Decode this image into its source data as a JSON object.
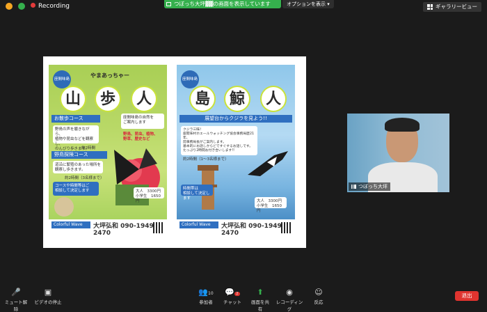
{
  "topbar": {
    "recording": "Recording",
    "share_banner": "つぼっち大坪▓▓の画面を表示しています",
    "options_button": "オプションを表示",
    "gallery_button": "ギャラリービュー"
  },
  "poster1": {
    "tag": "座間味島",
    "subtitle": "やまあっちゃー",
    "title_chars": [
      "山",
      "歩",
      "人"
    ],
    "course1_title": "お散歩コース",
    "course1_text": "座間味島の自然を\nご案内します",
    "course1_items": "野鳥、昆虫、植物、\n野草、歴史など",
    "course1_desc": "野鳥の声を聴きながら、\n植物や昆虫などを観察し、\nのんびり歩きます。",
    "course1_time": "約2時間",
    "course2_title": "野鳥探険コース",
    "course2_desc": "道沿に繁殖のあった場所を\n観察し歩きます。",
    "course2_time": "約2時間（3名様まで）",
    "note": "コースや時間等はご\n相談して決定します",
    "price": "大人　3300円\n小学生　1650円",
    "footer_logo": "Colorful Wave",
    "footer_name": "大坪弘和",
    "footer_phone": "090-1949-2470"
  },
  "poster2": {
    "tag": "座間味島",
    "title_chars": [
      "島",
      "鯨",
      "人"
    ],
    "banner": "展望台からクジラを見よう!!",
    "box_text": "クジラ三昧！\n座間味村ホエールウォッチング協会事務局歴21年、\n前事務局長がご案内します。\n基本的にお話しからどですぐするお話しです。\nたっぷり2時間お付き合いします!!",
    "time": "約2時間（1〜3名様まで）",
    "time_label": "時間帯は\n相談して決定します",
    "price": "大人　3300円\n小学生　1650円",
    "footer_logo": "Colorful Wave",
    "footer_name": "大坪弘和",
    "footer_phone": "090-1949-2470"
  },
  "video": {
    "name": "つぼっち大坪"
  },
  "toolbar": {
    "mute": "ミュート解除",
    "video": "ビデオの停止",
    "participants": "参加者",
    "participants_count": "10",
    "chat": "チャット",
    "chat_badge": "2",
    "share": "画面を共有",
    "record": "レコーディング",
    "reactions": "反応",
    "leave": "退出"
  },
  "colors": {
    "share_green": "#35b04d",
    "leave_red": "#e0342f",
    "poster_blue": "#2f6fc0"
  }
}
